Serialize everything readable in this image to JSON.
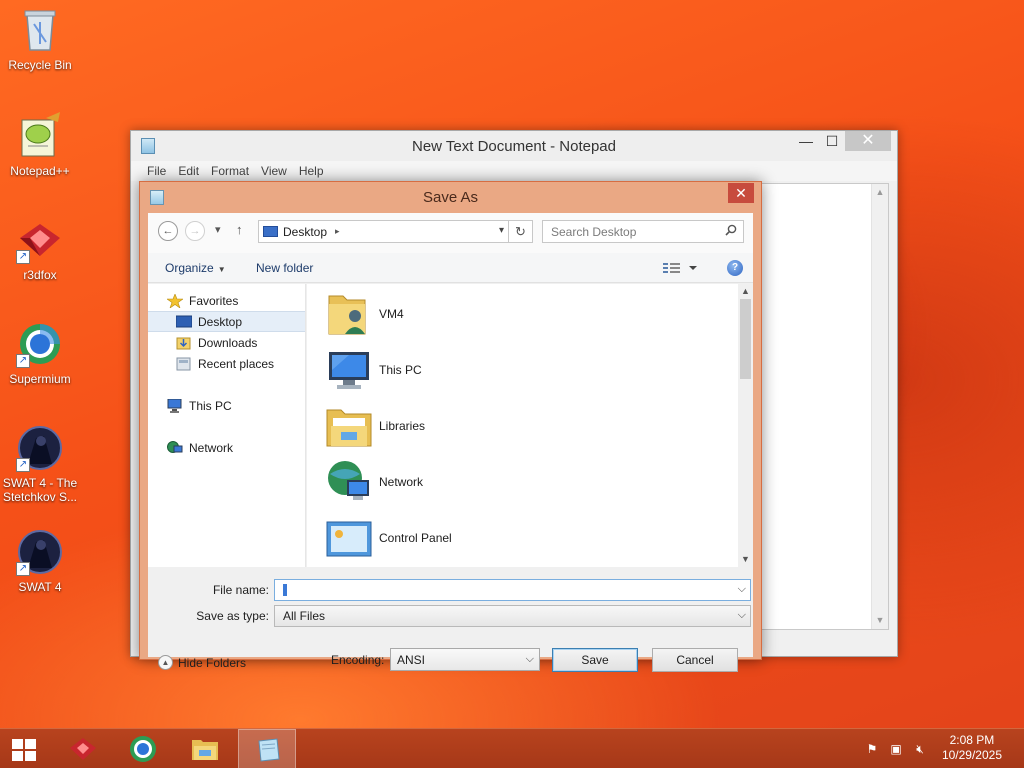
{
  "desktop": {
    "icons": [
      {
        "label": "Recycle Bin",
        "icon": "recycle-bin-icon"
      },
      {
        "label": "Notepad++",
        "icon": "notepad-plus-plus-icon"
      },
      {
        "label": "r3dfox",
        "icon": "r3dfox-icon"
      },
      {
        "label": "Supermium",
        "icon": "supermium-icon"
      },
      {
        "label": "SWAT 4 - The Stetchkov S...",
        "icon": "swat4-stetchkov-icon"
      },
      {
        "label": "SWAT 4",
        "icon": "swat4-icon"
      }
    ]
  },
  "notepad": {
    "title": "New Text Document - Notepad",
    "menu": [
      "File",
      "Edit",
      "Format",
      "View",
      "Help"
    ],
    "controls": {
      "minimize": "—",
      "maximize": "☐",
      "close": "✕"
    }
  },
  "dialog": {
    "title": "Save As",
    "close": "✕",
    "nav": {
      "back": "←",
      "forward": "→",
      "recent": "▾",
      "up": "↑"
    },
    "address": {
      "crumb": "Desktop",
      "refresh": "↻"
    },
    "search": {
      "placeholder": "Search Desktop"
    },
    "toolbar": {
      "organize": "Organize",
      "new_folder": "New folder",
      "help": "?"
    },
    "nav_pane": {
      "favorites": "Favorites",
      "desktop": "Desktop",
      "downloads": "Downloads",
      "recent_places": "Recent places",
      "this_pc": "This PC",
      "network": "Network"
    },
    "files": [
      {
        "name": "VM4",
        "icon": "user-folder-icon"
      },
      {
        "name": "This PC",
        "icon": "computer-icon"
      },
      {
        "name": "Libraries",
        "icon": "libraries-icon"
      },
      {
        "name": "Network",
        "icon": "network-icon"
      },
      {
        "name": "Control Panel",
        "icon": "control-panel-icon"
      }
    ],
    "form": {
      "file_name_label": "File name:",
      "file_name_value": "",
      "save_type_label": "Save as type:",
      "save_type_value": "All Files",
      "encoding_label": "Encoding:",
      "encoding_value": "ANSI",
      "hide_folders": "Hide Folders",
      "save": "Save",
      "cancel": "Cancel"
    }
  },
  "taskbar": {
    "apps": [
      "r3dfox-icon",
      "supermium-icon",
      "file-explorer-icon",
      "notepad-icon"
    ],
    "active_app": "notepad-icon",
    "time": "2:08 PM",
    "date": "10/29/2025"
  },
  "colors": {
    "desktop_bg": "#f55018",
    "dialog_frame": "#eaa884",
    "dialog_close": "#c74b3d",
    "taskbar": "#a63818"
  }
}
